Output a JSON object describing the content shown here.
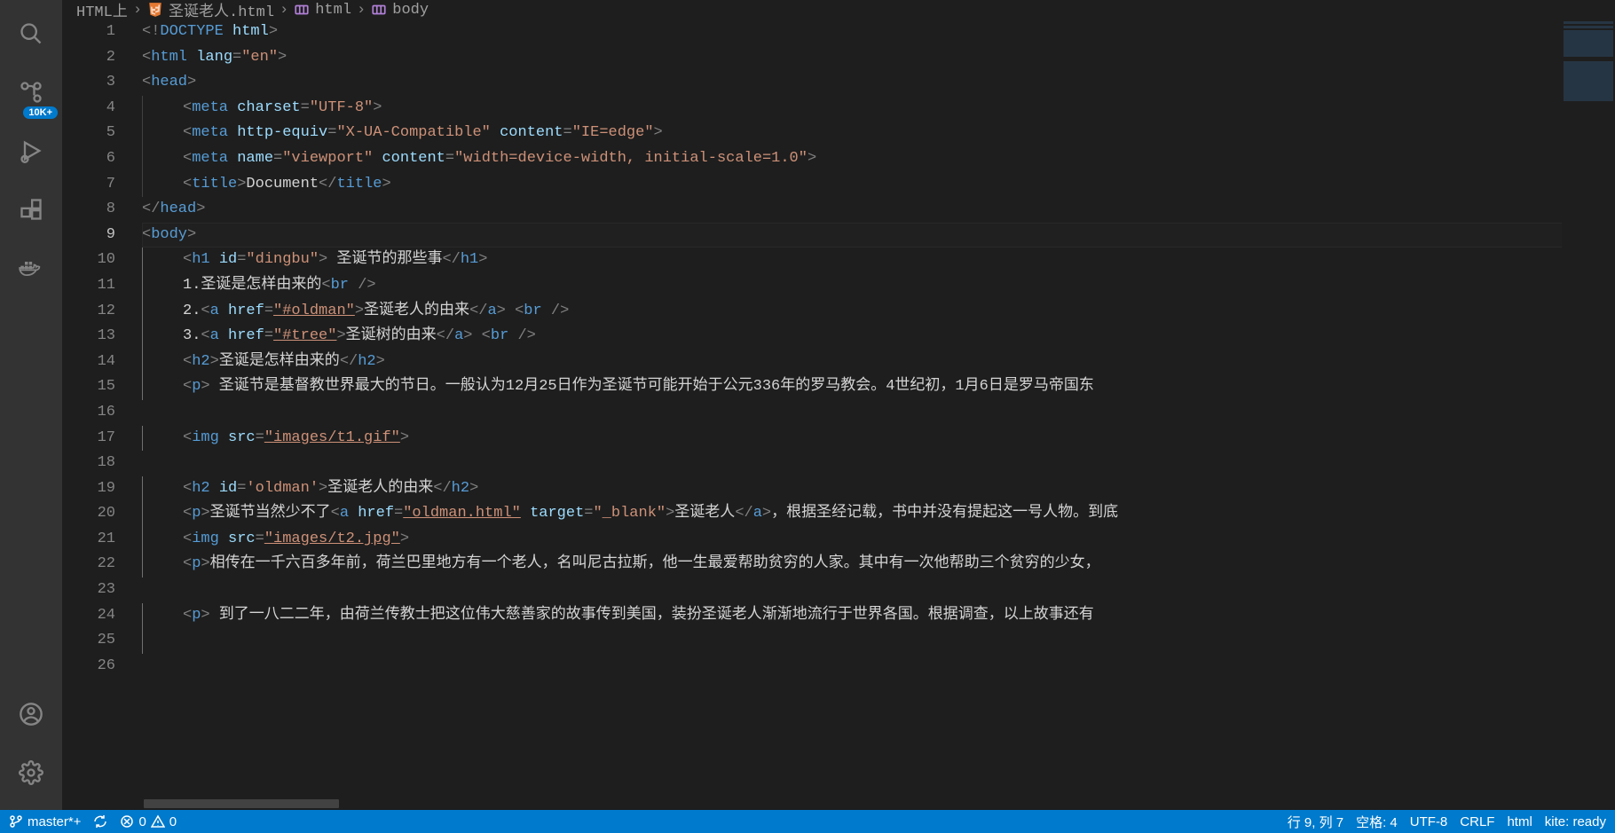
{
  "activity": {
    "badge": "10K+"
  },
  "breadcrumb": {
    "items": [
      "HTML上",
      "圣诞老人.html",
      "html",
      "body"
    ]
  },
  "gutterStart": 1,
  "gutterEnd": 26,
  "currentLine": 9,
  "code": [
    [
      [
        "p",
        "<!"
      ],
      [
        "t",
        "DOCTYPE"
      ],
      [
        "tx",
        " "
      ],
      [
        "an",
        "html"
      ],
      [
        "p",
        ">"
      ]
    ],
    [
      [
        "p",
        "<"
      ],
      [
        "t",
        "html"
      ],
      [
        "tx",
        " "
      ],
      [
        "an",
        "lang"
      ],
      [
        "p",
        "="
      ],
      [
        "av",
        "\"en\""
      ],
      [
        "p",
        ">"
      ]
    ],
    [
      [
        "p",
        "<"
      ],
      [
        "t",
        "head"
      ],
      [
        "p",
        ">"
      ]
    ],
    [
      [
        "indent",
        ""
      ],
      [
        "p",
        "<"
      ],
      [
        "t",
        "meta"
      ],
      [
        "tx",
        " "
      ],
      [
        "an",
        "charset"
      ],
      [
        "p",
        "="
      ],
      [
        "av",
        "\"UTF-8\""
      ],
      [
        "p",
        ">"
      ]
    ],
    [
      [
        "indent",
        ""
      ],
      [
        "p",
        "<"
      ],
      [
        "t",
        "meta"
      ],
      [
        "tx",
        " "
      ],
      [
        "an",
        "http-equiv"
      ],
      [
        "p",
        "="
      ],
      [
        "av",
        "\"X-UA-Compatible\""
      ],
      [
        "tx",
        " "
      ],
      [
        "an",
        "content"
      ],
      [
        "p",
        "="
      ],
      [
        "av",
        "\"IE=edge\""
      ],
      [
        "p",
        ">"
      ]
    ],
    [
      [
        "indent",
        ""
      ],
      [
        "p",
        "<"
      ],
      [
        "t",
        "meta"
      ],
      [
        "tx",
        " "
      ],
      [
        "an",
        "name"
      ],
      [
        "p",
        "="
      ],
      [
        "av",
        "\"viewport\""
      ],
      [
        "tx",
        " "
      ],
      [
        "an",
        "content"
      ],
      [
        "p",
        "="
      ],
      [
        "av",
        "\"width=device-width, initial-scale=1.0\""
      ],
      [
        "p",
        ">"
      ]
    ],
    [
      [
        "indent",
        ""
      ],
      [
        "p",
        "<"
      ],
      [
        "t",
        "title"
      ],
      [
        "p",
        ">"
      ],
      [
        "tx",
        "Document"
      ],
      [
        "p",
        "</"
      ],
      [
        "t",
        "title"
      ],
      [
        "p",
        ">"
      ]
    ],
    [
      [
        "p",
        "</"
      ],
      [
        "t",
        "head"
      ],
      [
        "p",
        ">"
      ]
    ],
    [
      [
        "p",
        "<"
      ],
      [
        "t",
        "body"
      ],
      [
        "p",
        ">"
      ]
    ],
    [
      [
        "indent",
        ""
      ],
      [
        "p",
        "<"
      ],
      [
        "t",
        "h1"
      ],
      [
        "tx",
        " "
      ],
      [
        "an",
        "id"
      ],
      [
        "p",
        "="
      ],
      [
        "av",
        "\"dingbu\""
      ],
      [
        "p",
        ">"
      ],
      [
        "tx",
        " 圣诞节的那些事"
      ],
      [
        "p",
        "</"
      ],
      [
        "t",
        "h1"
      ],
      [
        "p",
        ">"
      ]
    ],
    [
      [
        "indent",
        ""
      ],
      [
        "tx",
        "1.圣诞是怎样由来的"
      ],
      [
        "p",
        "<"
      ],
      [
        "t",
        "br"
      ],
      [
        "tx",
        " "
      ],
      [
        "p",
        "/>"
      ]
    ],
    [
      [
        "indent",
        ""
      ],
      [
        "tx",
        "2."
      ],
      [
        "p",
        "<"
      ],
      [
        "t",
        "a"
      ],
      [
        "tx",
        " "
      ],
      [
        "an",
        "href"
      ],
      [
        "p",
        "="
      ],
      [
        "av und",
        "\"#oldman\""
      ],
      [
        "p",
        ">"
      ],
      [
        "tx",
        "圣诞老人的由来"
      ],
      [
        "p",
        "</"
      ],
      [
        "t",
        "a"
      ],
      [
        "p",
        ">"
      ],
      [
        "tx",
        " "
      ],
      [
        "p",
        "<"
      ],
      [
        "t",
        "br"
      ],
      [
        "tx",
        " "
      ],
      [
        "p",
        "/>"
      ]
    ],
    [
      [
        "indent",
        ""
      ],
      [
        "tx",
        "3."
      ],
      [
        "p",
        "<"
      ],
      [
        "t",
        "a"
      ],
      [
        "tx",
        " "
      ],
      [
        "an",
        "href"
      ],
      [
        "p",
        "="
      ],
      [
        "av und",
        "\"#tree\""
      ],
      [
        "p",
        ">"
      ],
      [
        "tx",
        "圣诞树的由来"
      ],
      [
        "p",
        "</"
      ],
      [
        "t",
        "a"
      ],
      [
        "p",
        ">"
      ],
      [
        "tx",
        " "
      ],
      [
        "p",
        "<"
      ],
      [
        "t",
        "br"
      ],
      [
        "tx",
        " "
      ],
      [
        "p",
        "/>"
      ]
    ],
    [
      [
        "indent",
        ""
      ],
      [
        "p",
        "<"
      ],
      [
        "t",
        "h2"
      ],
      [
        "p",
        ">"
      ],
      [
        "tx",
        "圣诞是怎样由来的"
      ],
      [
        "p",
        "</"
      ],
      [
        "t",
        "h2"
      ],
      [
        "p",
        ">"
      ]
    ],
    [
      [
        "indent",
        ""
      ],
      [
        "p",
        "<"
      ],
      [
        "t",
        "p"
      ],
      [
        "p",
        ">"
      ],
      [
        "tx",
        " 圣诞节是基督教世界最大的节日。一般认为12月25日作为圣诞节可能开始于公元336年的罗马教会。4世纪初，1月6日是罗马帝国东"
      ]
    ],
    [],
    [
      [
        "indent",
        ""
      ],
      [
        "p",
        "<"
      ],
      [
        "t",
        "img"
      ],
      [
        "tx",
        " "
      ],
      [
        "an",
        "src"
      ],
      [
        "p",
        "="
      ],
      [
        "av und",
        "\"images/t1.gif\""
      ],
      [
        "p",
        ">"
      ]
    ],
    [],
    [
      [
        "indent",
        ""
      ],
      [
        "p",
        "<"
      ],
      [
        "t",
        "h2"
      ],
      [
        "tx",
        " "
      ],
      [
        "an",
        "id"
      ],
      [
        "p",
        "="
      ],
      [
        "av",
        "'oldman'"
      ],
      [
        "p",
        ">"
      ],
      [
        "tx",
        "圣诞老人的由来"
      ],
      [
        "p",
        "</"
      ],
      [
        "t",
        "h2"
      ],
      [
        "p",
        ">"
      ]
    ],
    [
      [
        "indent",
        ""
      ],
      [
        "p",
        "<"
      ],
      [
        "t",
        "p"
      ],
      [
        "p",
        ">"
      ],
      [
        "tx",
        "圣诞节当然少不了"
      ],
      [
        "p",
        "<"
      ],
      [
        "t",
        "a"
      ],
      [
        "tx",
        " "
      ],
      [
        "an",
        "href"
      ],
      [
        "p",
        "="
      ],
      [
        "av und",
        "\"oldman.html\""
      ],
      [
        "tx",
        " "
      ],
      [
        "an",
        "target"
      ],
      [
        "p",
        "="
      ],
      [
        "av",
        "\"_blank\""
      ],
      [
        "p",
        ">"
      ],
      [
        "tx",
        "圣诞老人"
      ],
      [
        "p",
        "</"
      ],
      [
        "t",
        "a"
      ],
      [
        "p",
        ">"
      ],
      [
        "tx",
        "，根据圣经记载，书中并没有提起这一号人物。到底"
      ]
    ],
    [
      [
        "indent",
        ""
      ],
      [
        "p",
        "<"
      ],
      [
        "t",
        "img"
      ],
      [
        "tx",
        " "
      ],
      [
        "an",
        "src"
      ],
      [
        "p",
        "="
      ],
      [
        "av und",
        "\"images/t2.jpg\""
      ],
      [
        "p",
        ">"
      ]
    ],
    [
      [
        "indent",
        ""
      ],
      [
        "p",
        "<"
      ],
      [
        "t",
        "p"
      ],
      [
        "p",
        ">"
      ],
      [
        "tx",
        "相传在一千六百多年前，荷兰巴里地方有一个老人，名叫尼古拉斯，他一生最爱帮助贫穷的人家。其中有一次他帮助三个贫穷的少女，"
      ]
    ],
    [],
    [
      [
        "indent",
        ""
      ],
      [
        "p",
        "<"
      ],
      [
        "t",
        "p"
      ],
      [
        "p",
        ">"
      ],
      [
        "tx",
        " 到了一八二二年，由荷兰传教士把这位伟大慈善家的故事传到美国，装扮圣诞老人渐渐地流行于世界各国。根据调查，以上故事还有"
      ]
    ],
    [
      [
        "indent",
        ""
      ]
    ],
    []
  ],
  "status": {
    "branch": "master*+",
    "errors": "0",
    "warnings": "0",
    "cursor": "行 9, 列 7",
    "spaces": "空格: 4",
    "encoding": "UTF-8",
    "eol": "CRLF",
    "lang": "html",
    "kite": "kite: ready"
  }
}
